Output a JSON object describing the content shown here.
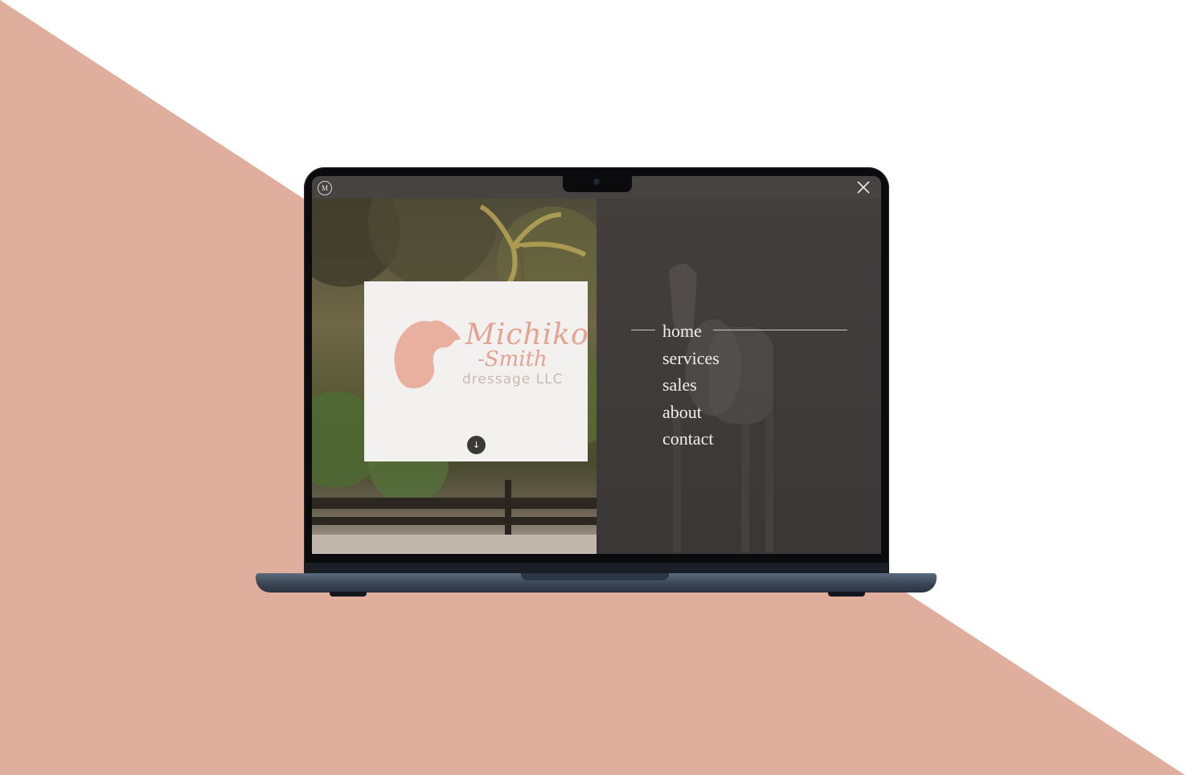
{
  "site": {
    "badge_letter": "M",
    "brand": {
      "line1": "Michiko",
      "line2": "-Smith",
      "line3": "dressage LLC"
    },
    "scroll_label": "↓",
    "close_label": "close",
    "nav": {
      "items": [
        {
          "label": "home"
        },
        {
          "label": "services"
        },
        {
          "label": "sales"
        },
        {
          "label": "about"
        },
        {
          "label": "contact"
        }
      ]
    }
  },
  "colors": {
    "background_accent": "#e0ae9d",
    "brand_pink": "#e4a292",
    "menu_overlay": "#3a3836",
    "laptop_base": "#3a4656"
  },
  "icons": [
    "close-icon",
    "arrow-down-icon",
    "horse-head-logo"
  ]
}
